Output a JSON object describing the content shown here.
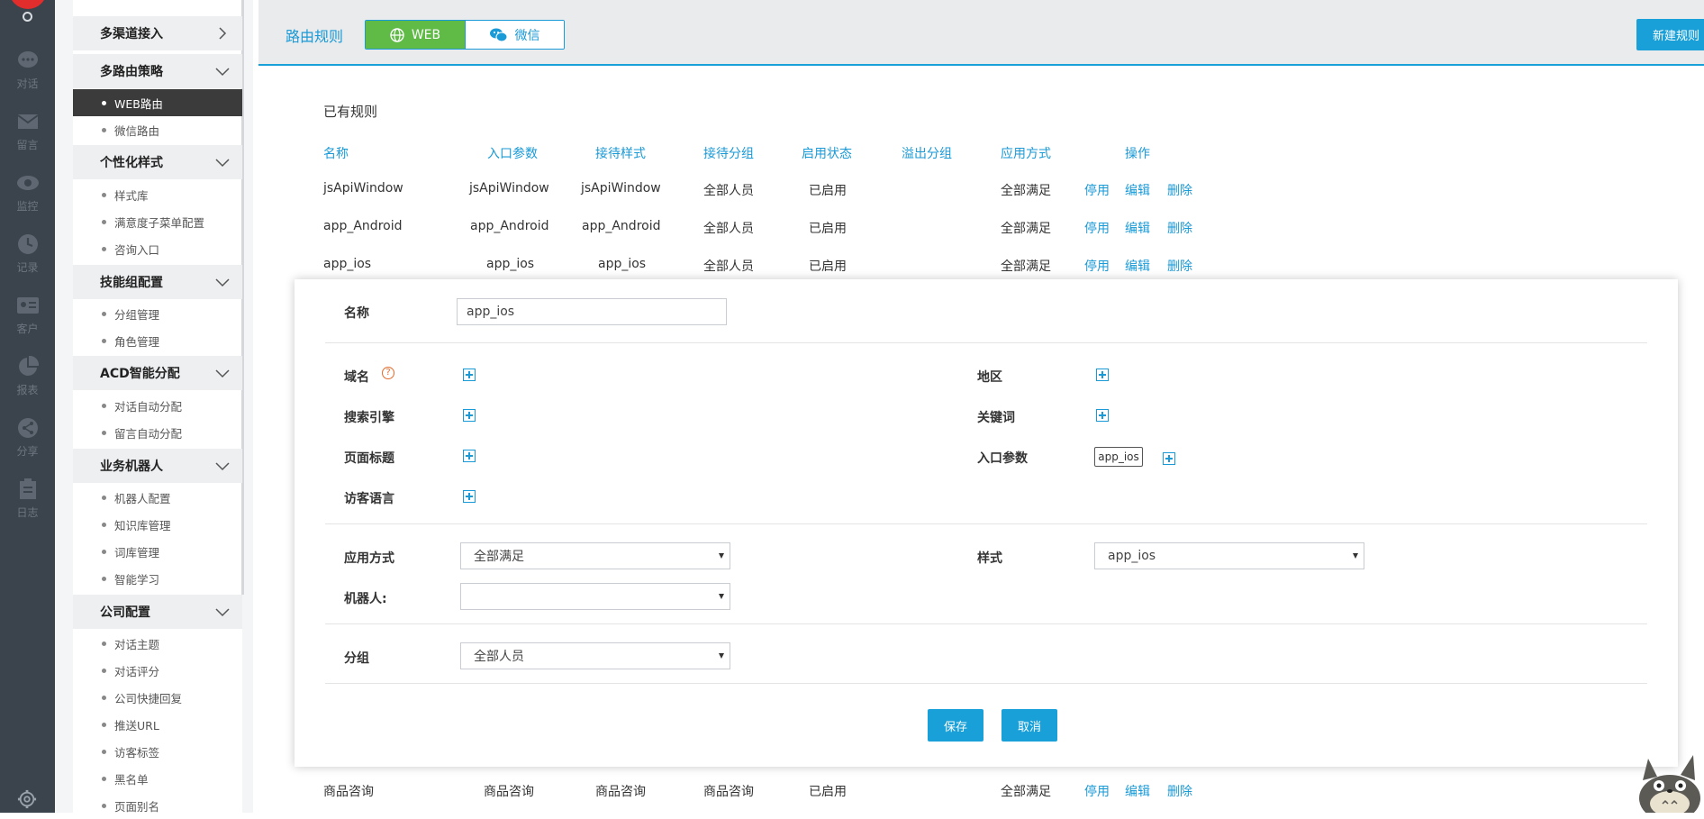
{
  "rail": {
    "items": [
      {
        "label": "对话",
        "icon": "chat-bubble-icon"
      },
      {
        "label": "留言",
        "icon": "envelope-icon"
      },
      {
        "label": "监控",
        "icon": "eye-icon"
      },
      {
        "label": "记录",
        "icon": "clock-icon"
      },
      {
        "label": "客户",
        "icon": "id-card-icon"
      },
      {
        "label": "报表",
        "icon": "pie-chart-icon"
      },
      {
        "label": "分享",
        "icon": "share-icon"
      },
      {
        "label": "日志",
        "icon": "clipboard-icon"
      }
    ]
  },
  "sidebar": {
    "sections": [
      {
        "title": "多渠道接入",
        "items": []
      },
      {
        "title": "多路由策略",
        "items": [
          "WEB路由",
          "微信路由"
        ]
      },
      {
        "title": "个性化样式",
        "items": [
          "样式库",
          "满意度子菜单配置",
          "咨询入口"
        ]
      },
      {
        "title": "技能组配置",
        "items": [
          "分组管理",
          "角色管理"
        ]
      },
      {
        "title": "ACD智能分配",
        "items": [
          "对话自动分配",
          "留言自动分配"
        ]
      },
      {
        "title": "业务机器人",
        "items": [
          "机器人配置",
          "知识库管理",
          "词库管理",
          "智能学习"
        ]
      },
      {
        "title": "公司配置",
        "items": [
          "对话主题",
          "对话评分",
          "公司快捷回复",
          "推送URL",
          "访客标签",
          "黑名单",
          "页面别名"
        ]
      }
    ],
    "active_item": "WEB路由"
  },
  "header": {
    "title": "路由规则",
    "tab_web": "WEB",
    "tab_wechat": "微信",
    "new_rule": "新建规则"
  },
  "rules": {
    "title": "已有规则",
    "columns": [
      "名称",
      "入口参数",
      "接待样式",
      "接待分组",
      "启用状态",
      "溢出分组",
      "应用方式",
      "操作"
    ],
    "rows": [
      {
        "name": "jsApiWindow",
        "param": "jsApiWindow",
        "style": "jsApiWindow",
        "group": "全部人员",
        "status": "已启用",
        "overflow": "",
        "apply": "全部满足"
      },
      {
        "name": "app_Android",
        "param": "app_Android",
        "style": "app_Android",
        "group": "全部人员",
        "status": "已启用",
        "overflow": "",
        "apply": "全部满足"
      },
      {
        "name": "app_ios",
        "param": "app_ios",
        "style": "app_ios",
        "group": "全部人员",
        "status": "已启用",
        "overflow": "",
        "apply": "全部满足"
      },
      {
        "name": "商品咨询",
        "param": "商品咨询",
        "style": "商品咨询",
        "group": "商品咨询",
        "status": "已启用",
        "overflow": "",
        "apply": "全部满足"
      }
    ],
    "ops": [
      "停用",
      "编辑",
      "删除"
    ]
  },
  "dialog": {
    "name_label": "名称",
    "name_value": "app_ios",
    "domain_label": "域名",
    "region_label": "地区",
    "search_engine_label": "搜索引擎",
    "keyword_label": "关键词",
    "page_title_label": "页面标题",
    "entry_param_label": "入口参数",
    "entry_param_tag": "app_ios",
    "visitor_lang_label": "访客语言",
    "apply_label": "应用方式",
    "apply_value": "全部满足",
    "style_label": "样式",
    "style_value": "app_ios",
    "robot_label": "机器人:",
    "robot_value": "",
    "group_label": "分组",
    "group_value": "全部人员",
    "save": "保存",
    "cancel": "取消"
  },
  "colors": {
    "accent": "#1a9ad6",
    "active_tab": "#5fba46",
    "rail_bg": "#3b434c",
    "logo": "#e22d2d"
  }
}
